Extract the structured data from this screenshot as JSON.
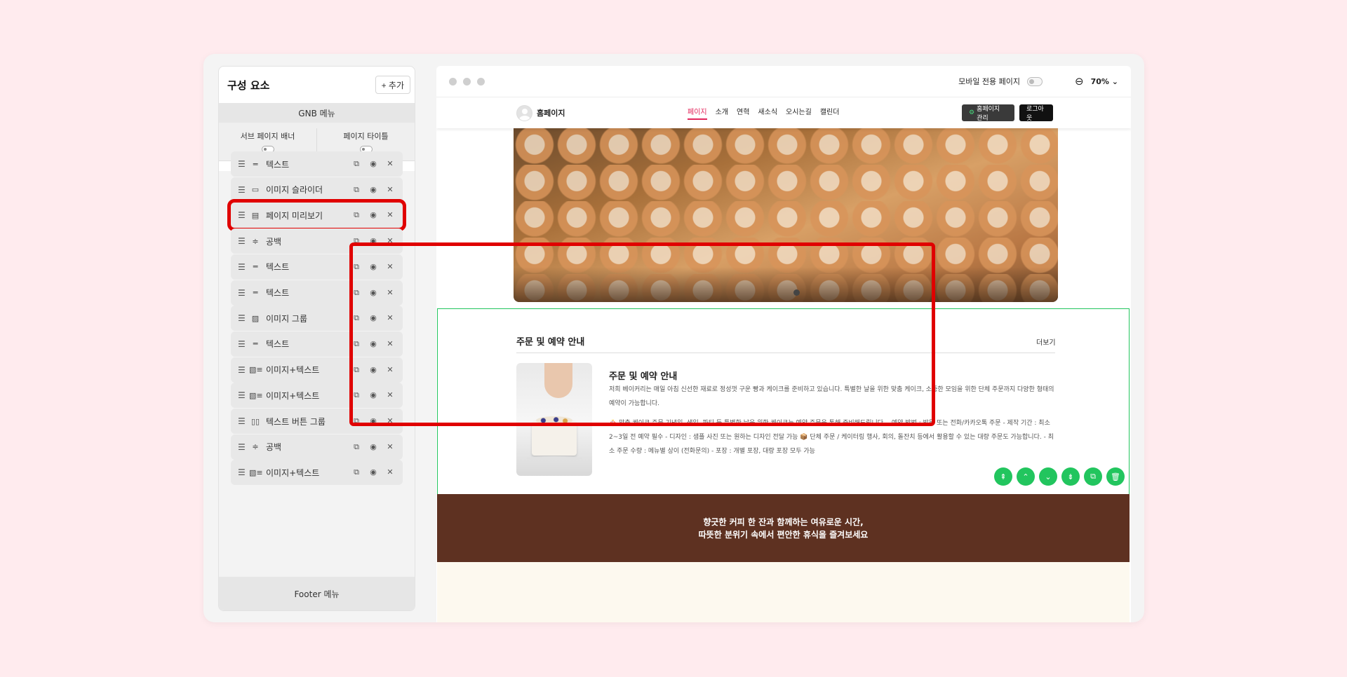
{
  "panel": {
    "title": "구성 요소",
    "add_label": "+ 추가",
    "gnb_label": "GNB 메뉴",
    "toggle_sub_banner": "서브 페이지 배너",
    "toggle_page_title": "페이지 타이틀",
    "footer_label": "Footer 메뉴",
    "items": [
      {
        "label": "텍스트",
        "icon": "text-icon"
      },
      {
        "label": "이미지 슬라이더",
        "icon": "slider-icon"
      },
      {
        "label": "페이지 미리보기",
        "icon": "preview-icon",
        "highlighted": true
      },
      {
        "label": "공백",
        "icon": "spacer-icon"
      },
      {
        "label": "텍스트",
        "icon": "text-icon"
      },
      {
        "label": "텍스트",
        "icon": "text-icon"
      },
      {
        "label": "이미지 그룹",
        "icon": "image-group-icon"
      },
      {
        "label": "텍스트",
        "icon": "text-icon"
      },
      {
        "label": "이미지+텍스트",
        "icon": "image-text-icon"
      },
      {
        "label": "이미지+텍스트",
        "icon": "image-text-icon"
      },
      {
        "label": "텍스트 버튼 그룹",
        "icon": "text-button-group-icon"
      },
      {
        "label": "공백",
        "icon": "spacer-icon"
      },
      {
        "label": "이미지+텍스트",
        "icon": "image-text-icon"
      }
    ]
  },
  "preview": {
    "mobile_label": "모바일 전용 페이지",
    "zoom": "70%",
    "site": {
      "logo_text": "홈페이지",
      "menu": [
        "페이지",
        "소개",
        "연혁",
        "새소식",
        "오시는길",
        "캘린더"
      ],
      "active_menu_index": 0,
      "manage_label": "홈페이지 관리",
      "logout_label": "로그아웃"
    },
    "section": {
      "title": "주문 및 예약 안내",
      "more": "더보기",
      "article_title": "주문 및 예약 안내",
      "para1": "저희 베이커리는 매일 아침 신선한 재료로 정성껏 구운 빵과 케이크를 준비하고 있습니다. 특별한 날을 위한 맞춤 케이크, 소중한 모임을 위한 단체 주문까지 다양한 형태의 예약이 가능합니다.",
      "para2": "🎂 맞춤 케이크 주문 기념일, 생일, 파티 등 특별한 날을 위한 케이크는 예약 주문을 통해 준비해드립니다. - 예약 방법 : 방문 또는 전화/카카오톡 주문 - 제작 기간 : 최소 2~3일 전 예약 필수 - 디자인 : 샘플 사진 또는 원하는 디자인 전달 가능 📦 단체 주문 / 케이터링 행사, 회의, 돌잔치 등에서 활용할 수 있는 대량 주문도 가능합니다. - 최소 주문 수량 : 메뉴별 상이 (전화문의) - 포장 : 개별 포장, 대량 포장 모두 가능"
    },
    "banner_line1": "향긋한 커피 한 잔과 함께하는 여유로운 시간,",
    "banner_line2": "따뜻한 분위기 속에서 편안한 휴식을 즐겨보세요"
  },
  "colors": {
    "accent": "#e2245a",
    "select_green": "#22c55e",
    "highlight_red": "#e00000",
    "banner_brown": "#5e3121"
  }
}
